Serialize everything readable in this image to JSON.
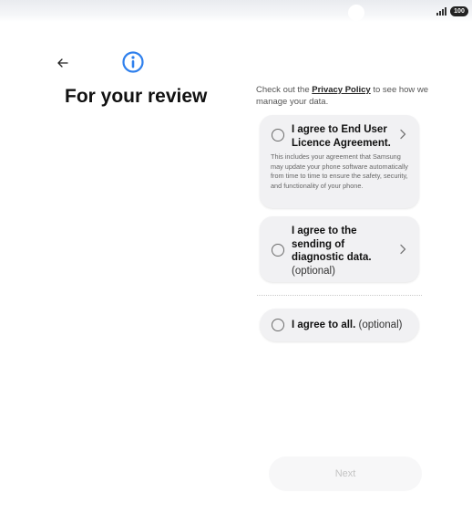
{
  "status_bar": {
    "signal_icon": "signal-bars-icon",
    "battery_level": "100"
  },
  "header": {
    "back_icon": "back-arrow-icon",
    "info_icon": "info-icon",
    "accent_color": "#2f80ed",
    "title": "For your review"
  },
  "privacy": {
    "prefix": "Check out the ",
    "link": "Privacy Policy",
    "suffix": " to see how we manage your data."
  },
  "agreements": {
    "eula": {
      "title": "I agree to End User Licence Agreement.",
      "description": "This includes your agreement that Samsung may update your phone software automatically from time to time to ensure the safety, security, and functionality of your phone.",
      "checked": false
    },
    "diagnostic": {
      "title": "I agree to the sending of diagnostic data.",
      "optional": "(optional)",
      "checked": false
    },
    "all": {
      "title": "I agree to all.",
      "optional": "(optional)",
      "checked": false
    }
  },
  "footer": {
    "next_label": "Next",
    "next_enabled": false
  }
}
